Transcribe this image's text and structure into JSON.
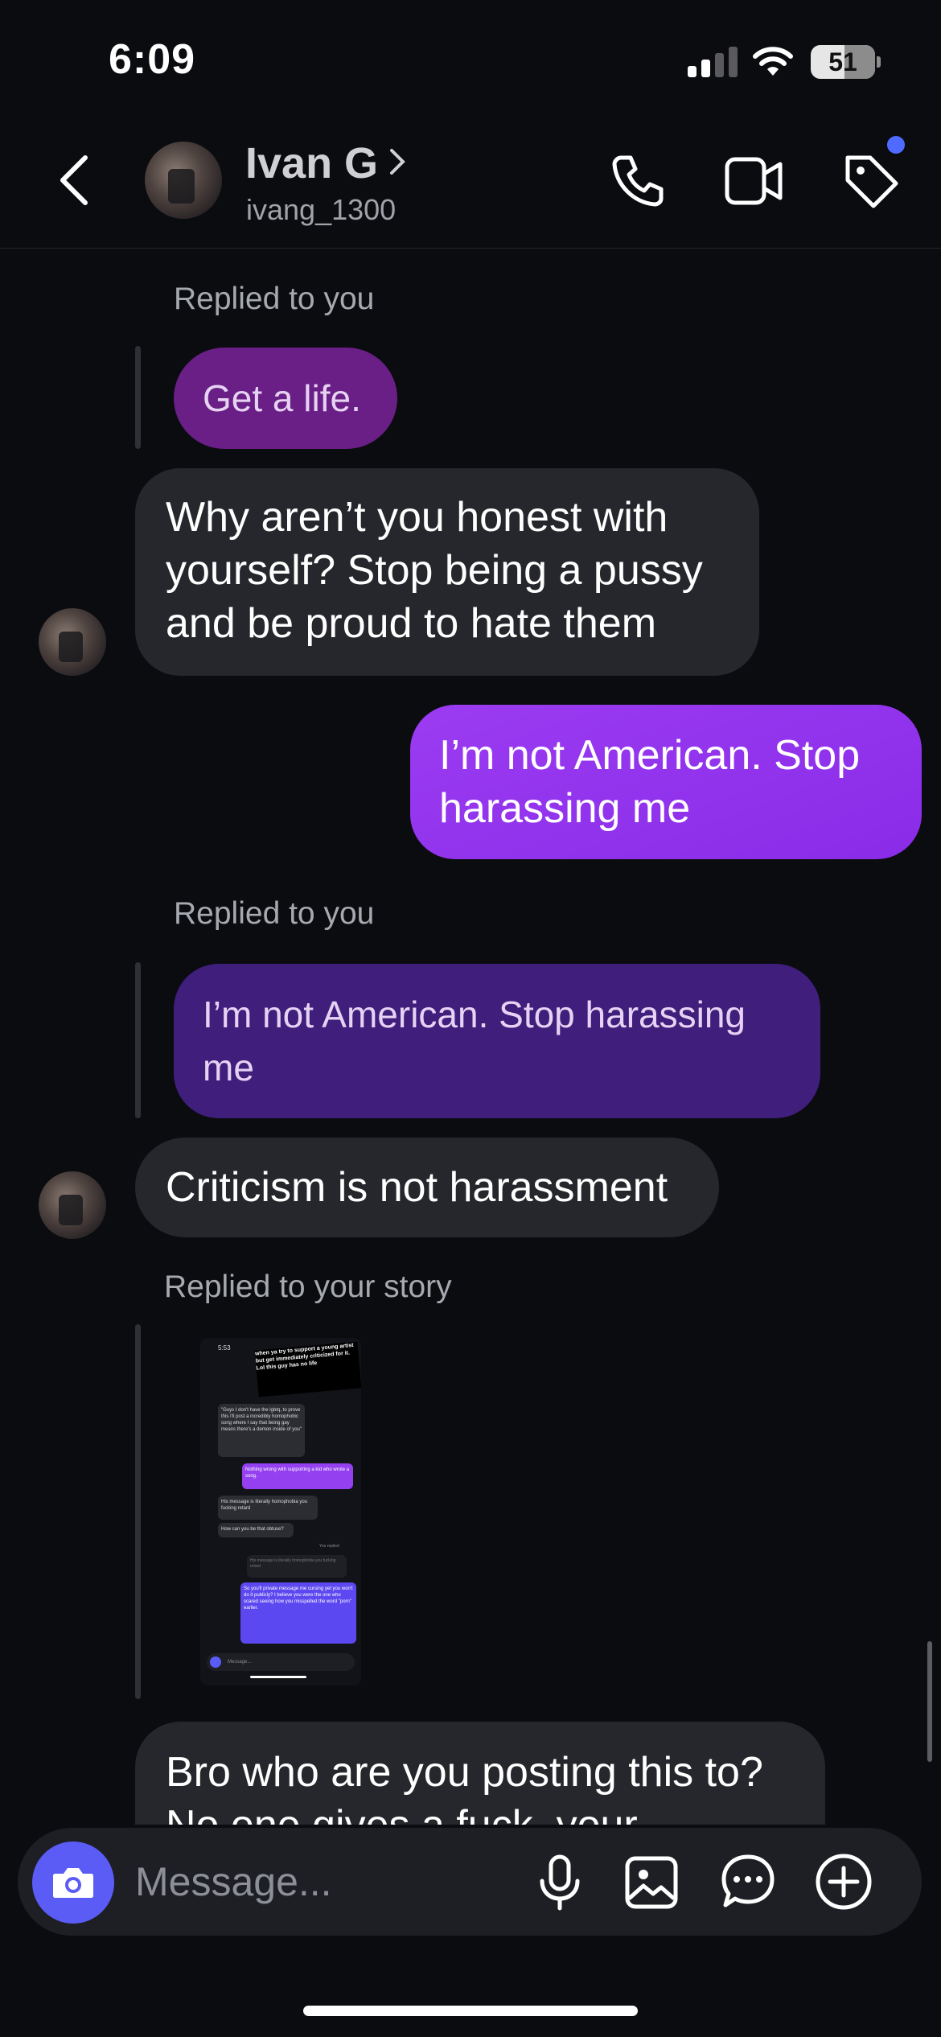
{
  "status_bar": {
    "time": "6:09",
    "battery": "51"
  },
  "header": {
    "back_icon": "chevron-left-icon",
    "name": "Ivan G",
    "handle": "ivang_1300",
    "actions": [
      "phone-icon",
      "video-icon",
      "tag-icon"
    ],
    "accent_dot_color": "#4f6bff"
  },
  "messages": [
    {
      "type": "reply",
      "label": "Replied to you",
      "quoted": "Get a life."
    },
    {
      "type": "incoming",
      "text": "Why aren’t you honest with yourself? Stop being a pussy and be proud to hate them"
    },
    {
      "type": "outgoing",
      "text": "I’m not American. Stop harassing me"
    },
    {
      "type": "reply",
      "label": "Replied to you",
      "quoted": "I’m not American. Stop harassing me"
    },
    {
      "type": "incoming",
      "text": "Criticism is not harassment"
    },
    {
      "type": "story_reply",
      "label": "Replied to your story"
    },
    {
      "type": "incoming",
      "text": "Bro who are you posting this to? No one gives a fuck, your"
    }
  ],
  "story_thumbnail": {
    "time": "5:53",
    "caption": "when ya try to support a young artist but get immediately criticized for it. Lol this guy has no life",
    "lines": [
      "\"Guys I don't have the lgbtq, to prove this I'll post a incredibly homophobic song where I say that being gay means there's a demon inside of you\"",
      "Nothing wrong with supporting a kid who wrote a song.",
      "His message is literally homophobia you fucking retard",
      "How can you be that obtuse?",
      "You replied",
      "His message is literally homophobia you fucking retard",
      "So you'll private message me cursing yet you won't do it publicly? I believe you were the one who scared seeing how you misspelled the word \"porn\" earlier."
    ],
    "composer_placeholder": "Message..."
  },
  "composer": {
    "placeholder": "Message...",
    "icons": [
      "camera-icon",
      "microphone-icon",
      "gallery-icon",
      "sticker-chat-icon",
      "plus-icon"
    ],
    "camera_color": "#5b5cf6"
  }
}
